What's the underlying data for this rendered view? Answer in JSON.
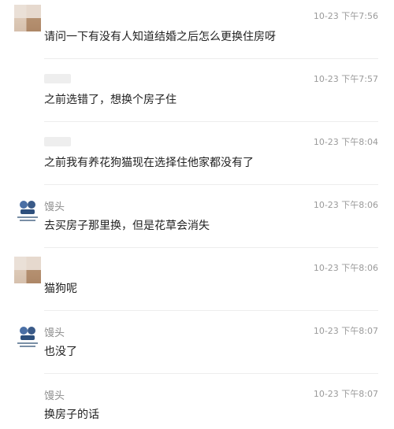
{
  "messages": [
    {
      "avatar": "pixelated-avatar",
      "name": "",
      "time": "10-23 下午7:56",
      "text": "请问一下有没有人知道结婚之后怎么更换住房呀"
    },
    {
      "avatar": "none",
      "name": "",
      "time": "10-23 下午7:57",
      "text": "之前选错了，想换个房子住"
    },
    {
      "avatar": "none",
      "name": "",
      "time": "10-23 下午8:04",
      "text": "之前我有养花狗猫现在选择住他家都没有了"
    },
    {
      "avatar": "cartoon-avatar",
      "name": "馒头",
      "time": "10-23 下午8:06",
      "text": "去买房子那里换，但是花草会消失"
    },
    {
      "avatar": "pixelated-avatar",
      "name": "",
      "time": "10-23 下午8:06",
      "text": "猫狗呢"
    },
    {
      "avatar": "cartoon-avatar",
      "name": "馒头",
      "time": "10-23 下午8:07",
      "text": "也没了"
    },
    {
      "avatar": "none",
      "name": "馒头",
      "time": "10-23 下午8:07",
      "text": "换房子的话"
    }
  ]
}
